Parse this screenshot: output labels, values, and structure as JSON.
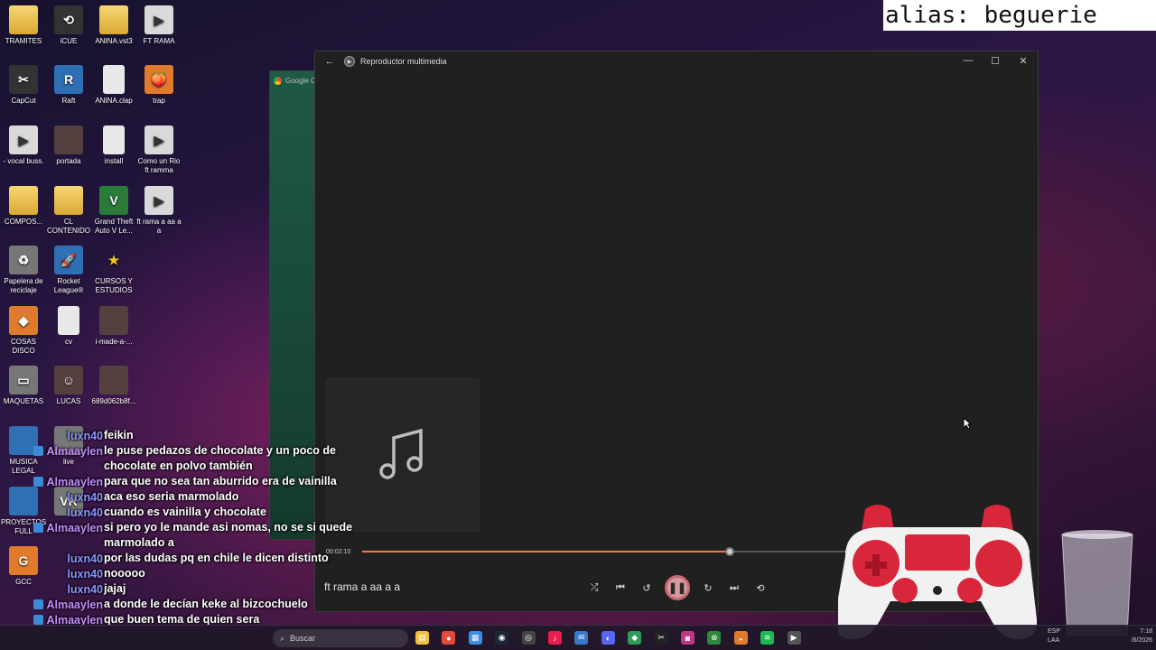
{
  "overlay": {
    "alias": "alias: beguerie"
  },
  "desktop_icons": [
    {
      "label": "TRAMITES",
      "glyph": "",
      "kind": "folder"
    },
    {
      "label": "iCUE",
      "glyph": "⟲",
      "kind": "app"
    },
    {
      "label": "ANINA.vst3",
      "glyph": "",
      "kind": "folder"
    },
    {
      "label": "FT RAMA",
      "glyph": "▶",
      "kind": "video"
    },
    {
      "label": "CapCut",
      "glyph": "✂",
      "kind": "app"
    },
    {
      "label": "Raft",
      "glyph": "R",
      "kind": "blue"
    },
    {
      "label": "ANINA.clap",
      "glyph": "",
      "kind": "file"
    },
    {
      "label": "trap",
      "glyph": "🍑",
      "kind": "orange"
    },
    {
      "label": "- vocal buss.",
      "glyph": "▶",
      "kind": "video"
    },
    {
      "label": "portada",
      "glyph": "",
      "kind": "dark"
    },
    {
      "label": "install",
      "glyph": "",
      "kind": "file"
    },
    {
      "label": "Como un Rio ft ramma",
      "glyph": "▶",
      "kind": "video"
    },
    {
      "label": "COMPOS...",
      "glyph": "",
      "kind": "folder"
    },
    {
      "label": "CL CONTENIDO",
      "glyph": "",
      "kind": "folder"
    },
    {
      "label": "Grand Theft Auto V Le...",
      "glyph": "V",
      "kind": "green"
    },
    {
      "label": "ft rama a aa a a",
      "glyph": "▶",
      "kind": "video"
    },
    {
      "label": "Papelera de reciclaje",
      "glyph": "♻",
      "kind": "gray"
    },
    {
      "label": "Rocket League®",
      "glyph": "🚀",
      "kind": "blue"
    },
    {
      "label": "CURSOS Y ESTUDIOS",
      "glyph": "★",
      "kind": "star"
    },
    {
      "label": "",
      "glyph": "",
      "kind": "none"
    },
    {
      "label": "COSAS DISCO",
      "glyph": "◆",
      "kind": "orange"
    },
    {
      "label": "cv",
      "glyph": "",
      "kind": "file"
    },
    {
      "label": "i-made-a-...",
      "glyph": "",
      "kind": "dark"
    },
    {
      "label": "",
      "glyph": "",
      "kind": "none"
    },
    {
      "label": "MAQUETAS",
      "glyph": "▭",
      "kind": "gray"
    },
    {
      "label": "LUCAS",
      "glyph": "☺",
      "kind": "dark"
    },
    {
      "label": "689d062b8f...",
      "glyph": "",
      "kind": "dark"
    },
    {
      "label": "",
      "glyph": "",
      "kind": "none"
    },
    {
      "label": "MUSICA LEGAL",
      "glyph": "",
      "kind": "blue"
    },
    {
      "label": "live",
      "glyph": "",
      "kind": "gray"
    },
    {
      "label": "",
      "glyph": "",
      "kind": "none"
    },
    {
      "label": "",
      "glyph": "",
      "kind": "none"
    },
    {
      "label": "PROYECTOS FULL",
      "glyph": "",
      "kind": "blue"
    },
    {
      "label": "",
      "glyph": "VR",
      "kind": "gray"
    },
    {
      "label": "",
      "glyph": "",
      "kind": "none"
    },
    {
      "label": "",
      "glyph": "",
      "kind": "none"
    },
    {
      "label": "GCC",
      "glyph": "G",
      "kind": "orange"
    }
  ],
  "chrome": {
    "tab_label": "Google C"
  },
  "player": {
    "title": "Reproductor multimedia",
    "back_icon": "←",
    "minimize_icon": "—",
    "maximize_icon": "☐",
    "close_icon": "✕",
    "current_time": "00:02:10",
    "progress": 0.55,
    "track_title": "ft rama a aa a a",
    "controls": {
      "shuffle": "⤮",
      "previous": "⏮",
      "rewind": "↺",
      "pause": "❚❚",
      "forward": "↻",
      "next": "⏭",
      "repeat": "⟲"
    }
  },
  "chat": [
    {
      "user": "luxn40",
      "text": "feikin",
      "style": "lux",
      "badge": false
    },
    {
      "user": "Almaaylen",
      "text": "le puse pedazos de chocolate y un poco de chocolate en polvo también",
      "style": "alm",
      "badge": true
    },
    {
      "user": "Almaaylen",
      "text": "para que no sea tan aburrido era de vainilla",
      "style": "alm",
      "badge": true
    },
    {
      "user": "luxn40",
      "text": "aca eso seria marmolado",
      "style": "lux",
      "badge": false
    },
    {
      "user": "luxn40",
      "text": "cuando es vainilla y chocolate",
      "style": "lux",
      "badge": false
    },
    {
      "user": "Almaaylen",
      "text": "si pero yo le mande asi nomas, no se si quede marmolado a",
      "style": "alm",
      "badge": true
    },
    {
      "user": "luxn40",
      "text": "por las dudas pq en chile le dicen distinto",
      "style": "lux",
      "badge": false
    },
    {
      "user": "luxn40",
      "text": "nooooo",
      "style": "lux",
      "badge": false
    },
    {
      "user": "luxn40",
      "text": "jajaj",
      "style": "lux",
      "badge": false
    },
    {
      "user": "Almaaylen",
      "text": "a donde le decían keke al bizcochuelo",
      "style": "alm",
      "badge": true
    },
    {
      "user": "Almaaylen",
      "text": "que buen tema de quien sera",
      "style": "alm",
      "badge": true
    }
  ],
  "taskbar": {
    "search_placeholder": "Buscar",
    "search_icon": "⌕",
    "apps": [
      {
        "name": "explorer",
        "glyph": "▤",
        "color": "#f0c040"
      },
      {
        "name": "chrome",
        "glyph": "●",
        "color": "#e04b3a"
      },
      {
        "name": "files",
        "glyph": "▦",
        "color": "#3a8ee6"
      },
      {
        "name": "steam",
        "glyph": "◉",
        "color": "#1b2838"
      },
      {
        "name": "github",
        "glyph": "◎",
        "color": "#444"
      },
      {
        "name": "tiktok",
        "glyph": "♪",
        "color": "#ee1d52"
      },
      {
        "name": "mail",
        "glyph": "✉",
        "color": "#3a79c9"
      },
      {
        "name": "discord",
        "glyph": "◐",
        "color": "#5865f2"
      },
      {
        "name": "app-green",
        "glyph": "◆",
        "color": "#2e9b5a"
      },
      {
        "name": "capcut",
        "glyph": "✂",
        "color": "#222"
      },
      {
        "name": "instagram",
        "glyph": "◙",
        "color": "#c13584"
      },
      {
        "name": "xbox",
        "glyph": "⊗",
        "color": "#2d8a3a"
      },
      {
        "name": "fl-studio",
        "glyph": "◒",
        "color": "#e07b2e"
      },
      {
        "name": "spotify",
        "glyph": "≋",
        "color": "#1db954"
      },
      {
        "name": "media-player",
        "glyph": "▶",
        "color": "#555"
      }
    ],
    "tray_lang": "ESP",
    "tray_layout": "LAA",
    "clock_time": "7:18",
    "clock_date": "/6/2026"
  }
}
